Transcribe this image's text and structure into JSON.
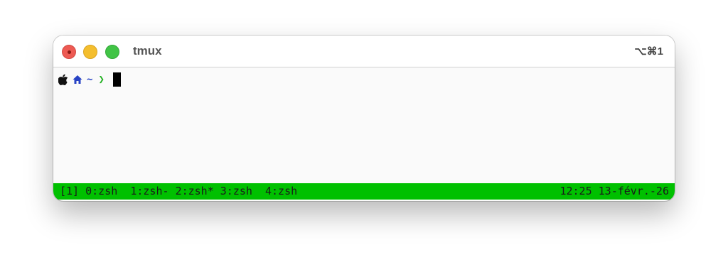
{
  "window": {
    "title": "tmux",
    "shortcut": "⌥⌘1"
  },
  "prompt": {
    "icons": [
      "apple-icon",
      "home-icon"
    ],
    "path": "~",
    "arrow": "❯"
  },
  "statusbar": {
    "session": "[1]",
    "windows": [
      {
        "label": "0:zsh"
      },
      {
        "label": "1:zsh-"
      },
      {
        "label": "2:zsh*"
      },
      {
        "label": "3:zsh"
      },
      {
        "label": "4:zsh"
      }
    ],
    "clock": "12:25 13-févr.-26",
    "color": "#00c000"
  }
}
